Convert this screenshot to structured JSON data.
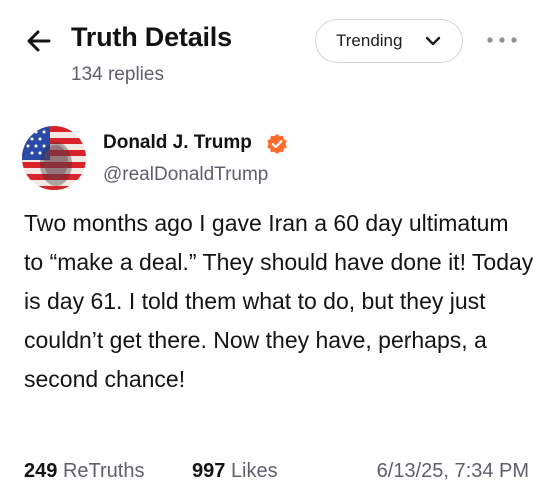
{
  "header": {
    "title": "Truth Details",
    "reply_count": "134 replies",
    "sort_label": "Trending"
  },
  "post": {
    "author_name": "Donald J. Trump",
    "handle": "@realDonaldTrump",
    "verified": true,
    "body": "Two months ago I gave Iran a 60 day ultimatum to “make a deal.” They should have done it! Today is day 61. I told them what to do, but they just couldn’t get there. Now they have, perhaps, a second chance!",
    "retruths_count": "249",
    "retruths_label": "ReTruths",
    "likes_count": "997",
    "likes_label": "Likes",
    "timestamp": "6/13/25, 7:34 PM"
  },
  "colors": {
    "verified": "#ff6b2c",
    "text": "#141414",
    "muted": "#5f5f6a",
    "border": "#d4d4d8"
  }
}
